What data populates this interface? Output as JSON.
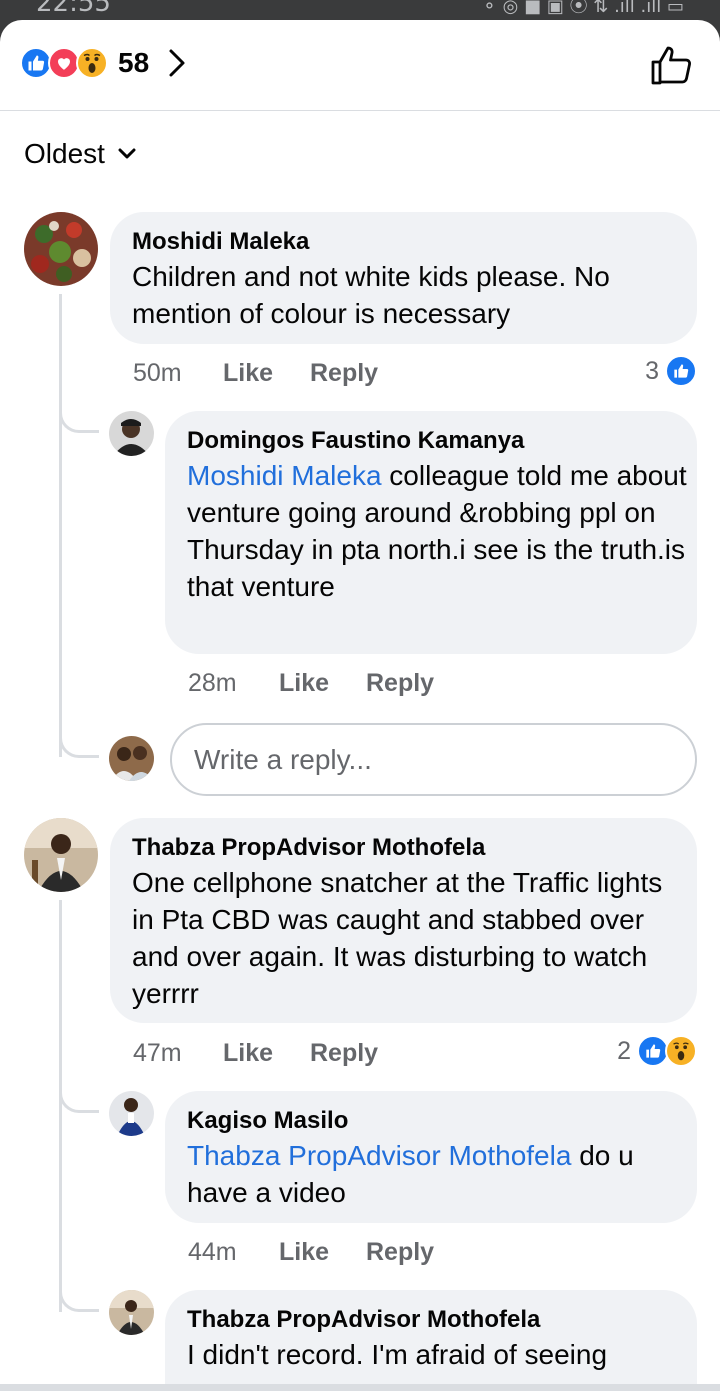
{
  "status_bar": {
    "time": "22:55",
    "icons": "⚬ ◎ ■   ▣ ⦿ ⇅ .ıll .ıll ▭"
  },
  "header": {
    "reaction_count": "58",
    "reactions": [
      "like",
      "love",
      "wow"
    ]
  },
  "sort": {
    "label": "Oldest"
  },
  "comments": [
    {
      "author": "Moshidi Maleka",
      "text": "Children and not white kids please. No mention of colour is necessary",
      "time": "50m",
      "like_label": "Like",
      "reply_label": "Reply",
      "reaction_count": "3",
      "replies": [
        {
          "author": "Domingos Faustino Kamanya",
          "mention": "Moshidi Maleka",
          "text": " colleague told me about venture going around &robbing ppl on Thursday in pta north.i see is the truth.is that venture",
          "time": "28m",
          "like_label": "Like",
          "reply_label": "Reply"
        }
      ],
      "reply_input_placeholder": "Write a reply..."
    },
    {
      "author": "Thabza PropAdvisor Mothofela",
      "text": "One cellphone snatcher at the Traffic lights in Pta CBD was caught and stabbed over and over again. It was disturbing to watch yerrrr",
      "time": "47m",
      "like_label": "Like",
      "reply_label": "Reply",
      "reaction_count": "2",
      "replies": [
        {
          "author": "Kagiso Masilo",
          "mention": "Thabza PropAdvisor Mothofela",
          "text": " do u have a video",
          "time": "44m",
          "like_label": "Like",
          "reply_label": "Reply"
        },
        {
          "author": "Thabza PropAdvisor Mothofela",
          "text": "I didn't record. I'm afraid of seeing"
        }
      ]
    }
  ],
  "colors": {
    "like_blue": "#1877f2",
    "love_red": "#f33e58",
    "wow_yellow": "#f7b125",
    "mention_blue": "#216fdb",
    "bubble_gray": "#f0f2f5",
    "meta_gray": "#65676b"
  }
}
